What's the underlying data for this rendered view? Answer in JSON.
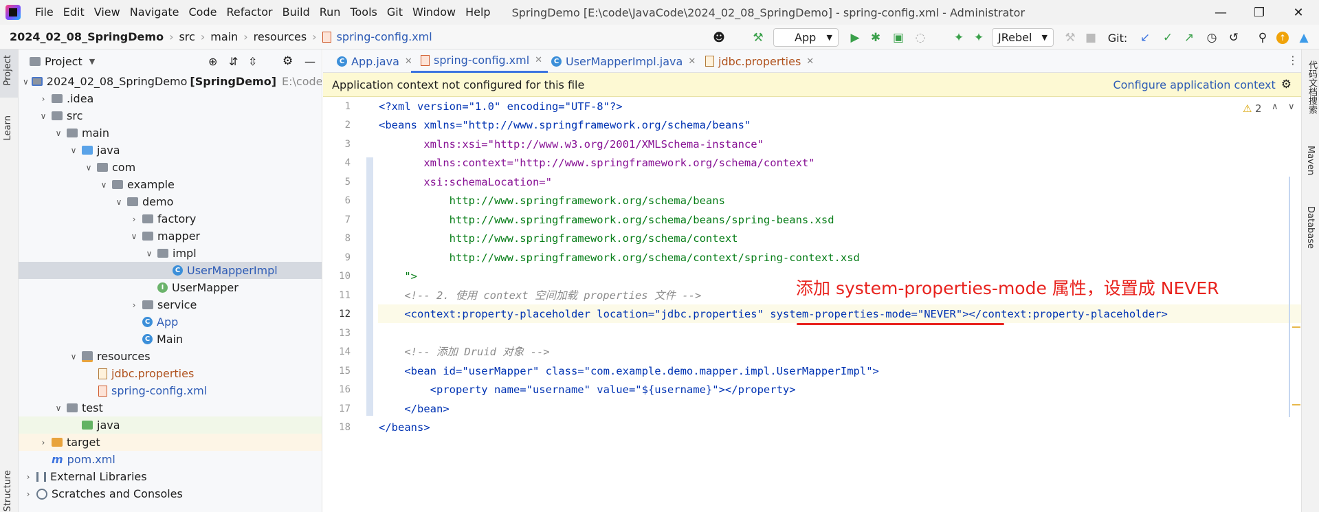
{
  "menubar": {
    "items": [
      "File",
      "Edit",
      "View",
      "Navigate",
      "Code",
      "Refactor",
      "Build",
      "Run",
      "Tools",
      "Git",
      "Window",
      "Help"
    ],
    "window_title": "SpringDemo [E:\\code\\JavaCode\\2024_02_08_SpringDemo] - spring-config.xml - Administrator"
  },
  "navbar": {
    "breadcrumbs": [
      "2024_02_08_SpringDemo",
      "src",
      "main",
      "resources",
      "spring-config.xml"
    ],
    "run_config": "App",
    "jrebel": "JRebel",
    "git_label": "Git:"
  },
  "left_stripe": {
    "project": "Project",
    "learn": "Learn",
    "structure": "Structure"
  },
  "right_stripe": {
    "doc_search": "代码文档搜索",
    "maven": "Maven",
    "database": "Database"
  },
  "project_panel": {
    "title": "Project",
    "tree": [
      {
        "label": "2024_02_08_SpringDemo",
        "bold_suffix": "[SpringDemo]",
        "path": "E:\\code\\Java"
      },
      {
        "label": ".idea"
      },
      {
        "label": "src"
      },
      {
        "label": "main"
      },
      {
        "label": "java"
      },
      {
        "label": "com"
      },
      {
        "label": "example"
      },
      {
        "label": "demo"
      },
      {
        "label": "factory"
      },
      {
        "label": "mapper"
      },
      {
        "label": "impl"
      },
      {
        "label": "UserMapperImpl"
      },
      {
        "label": "UserMapper"
      },
      {
        "label": "service"
      },
      {
        "label": "App"
      },
      {
        "label": "Main"
      },
      {
        "label": "resources"
      },
      {
        "label": "jdbc.properties"
      },
      {
        "label": "spring-config.xml"
      },
      {
        "label": "test"
      },
      {
        "label": "java"
      },
      {
        "label": "target"
      },
      {
        "label": "pom.xml"
      },
      {
        "label": "External Libraries"
      },
      {
        "label": "Scratches and Consoles"
      }
    ]
  },
  "tabs": [
    "App.java",
    "spring-config.xml",
    "UserMapperImpl.java",
    "jdbc.properties"
  ],
  "banner": {
    "message": "Application context not configured for this file",
    "action": "Configure application context"
  },
  "inspection": {
    "warnings": "2"
  },
  "editor": {
    "line_numbers": [
      "1",
      "2",
      "3",
      "4",
      "5",
      "6",
      "7",
      "8",
      "9",
      "10",
      "11",
      "12",
      "13",
      "14",
      "15",
      "16",
      "17",
      "18"
    ],
    "lines": [
      "<?xml version=\"1.0\" encoding=\"UTF-8\"?>",
      "<beans xmlns=\"http://www.springframework.org/schema/beans\"",
      "       xmlns:xsi=\"http://www.w3.org/2001/XMLSchema-instance\"",
      "       xmlns:context=\"http://www.springframework.org/schema/context\"",
      "       xsi:schemaLocation=\"",
      "           http://www.springframework.org/schema/beans",
      "           http://www.springframework.org/schema/beans/spring-beans.xsd",
      "           http://www.springframework.org/schema/context",
      "           http://www.springframework.org/schema/context/spring-context.xsd",
      "    \">",
      "    <!-- 2. 使用 context 空间加载 properties 文件 -->",
      "    <context:property-placeholder location=\"jdbc.properties\" system-properties-mode=\"NEVER\"></context:property-placeholder>",
      "",
      "    <!-- 添加 Druid 对象 -->",
      "    <bean id=\"userMapper\" class=\"com.example.demo.mapper.impl.UserMapperImpl\">",
      "        <property name=\"username\" value=\"${username}\"></property>",
      "    </bean>",
      "</beans>"
    ],
    "annotation": "添加 system-properties-mode 属性，设置成 NEVER"
  }
}
